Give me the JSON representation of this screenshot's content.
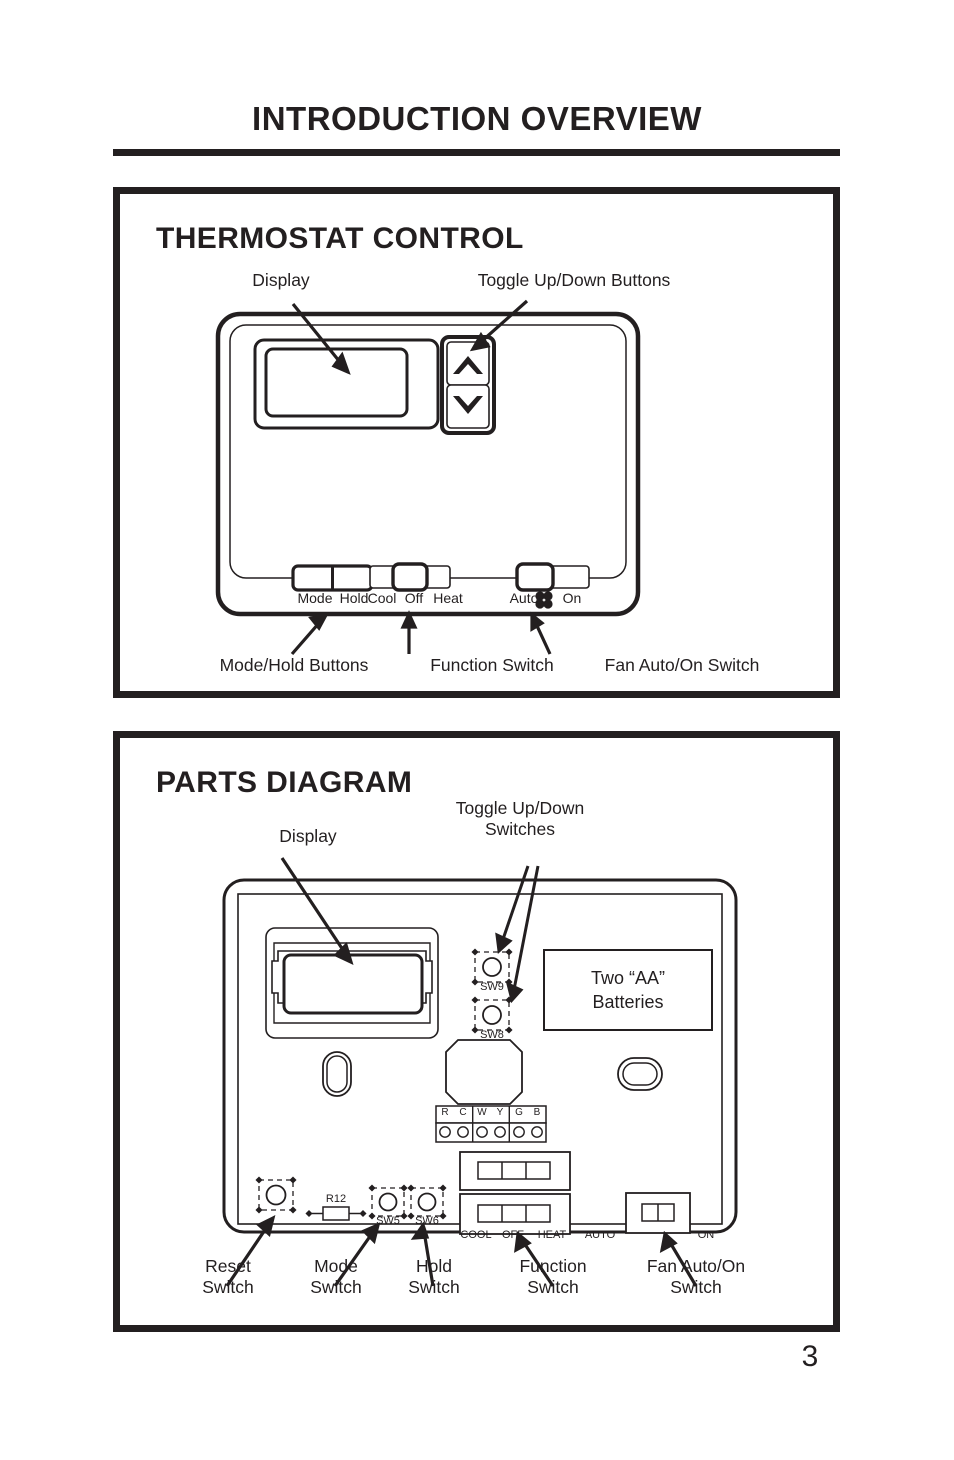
{
  "page": {
    "title": "INTRODUCTION OVERVIEW",
    "number": "3",
    "ink": "#231f20",
    "paper": "#ffffff"
  },
  "thermostat_panel": {
    "heading": "THERMOSTAT CONTROL",
    "callouts": {
      "display": "Display",
      "toggle_buttons": "Toggle Up/Down Buttons",
      "mode_hold": "Mode/Hold Buttons",
      "function_switch": "Function Switch",
      "fan_switch": "Fan Auto/On Switch"
    },
    "face_labels": {
      "mode": "Mode",
      "hold": "Hold",
      "cool": "Cool",
      "off": "Off",
      "heat": "Heat",
      "auto": "Auto",
      "on": "On",
      "fan_icon": "fan-blade-icon"
    },
    "toggle_icons": {
      "up": "chevron-up-icon",
      "down": "chevron-down-icon"
    }
  },
  "parts_panel": {
    "heading": "PARTS DIAGRAM",
    "callouts": {
      "display": "Display",
      "toggle_switches": "Toggle Up/Down\nSwitches",
      "reset_switch": "Reset\nSwitch",
      "mode_switch": "Mode\nSwitch",
      "hold_switch": "Hold\nSwitch",
      "function_switch": "Function\nSwitch",
      "fan_switch": "Fan Auto/On\nSwitch"
    },
    "board_labels": {
      "battery_compartment": "Two “AA”\nBatteries",
      "sw9": "SW9",
      "sw8": "SW8",
      "sw5": "SW5",
      "sw6": "SW6",
      "r12": "R12",
      "cool": "COOL",
      "off": "OFF",
      "heat": "HEAT",
      "auto": "AUTO",
      "on": "ON"
    },
    "terminal_block": {
      "terminals": [
        "R",
        "C",
        "W",
        "Y",
        "G",
        "B"
      ]
    }
  }
}
